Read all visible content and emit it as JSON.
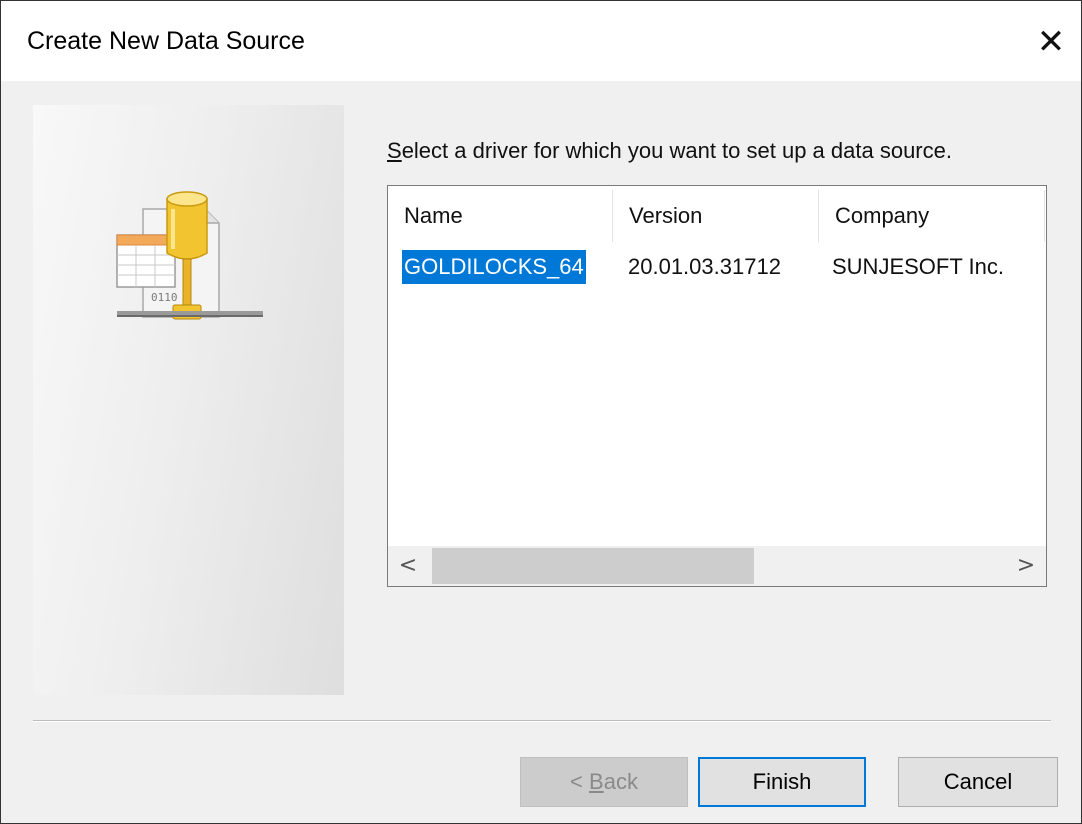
{
  "window": {
    "title": "Create New Data Source",
    "close_glyph": "✕"
  },
  "instruction": {
    "accel": "S",
    "rest": "elect a driver for which you want to set up a data source."
  },
  "drivers_list": {
    "columns": [
      "Name",
      "Version",
      "Company"
    ],
    "rows": [
      {
        "name": "GOLDILOCKS_64",
        "version": "20.01.03.31712",
        "company": "SUNJESOFT Inc.",
        "selected": true
      }
    ],
    "scroll_left_glyph": "<",
    "scroll_right_glyph": ">"
  },
  "buttons": {
    "back": {
      "prefix": "< ",
      "accel": "B",
      "rest": "ack",
      "enabled": false
    },
    "finish": {
      "label": "Finish",
      "default": true
    },
    "cancel": {
      "label": "Cancel"
    }
  },
  "icons": {
    "illustration": "odbc-database-network-icon",
    "close": "close-icon"
  },
  "colors": {
    "selection": "#0078d7",
    "default_button_border": "#0078d7"
  }
}
